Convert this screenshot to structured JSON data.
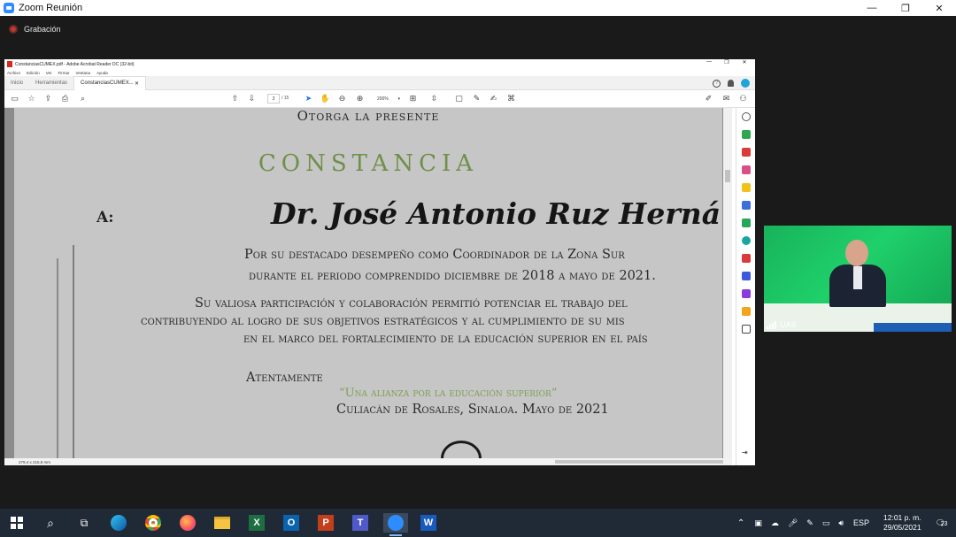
{
  "zoom": {
    "title": "Zoom Reunión",
    "recording_label": "Grabación",
    "participant_name": "UAS"
  },
  "acrobat": {
    "window_title": "ConstanciasCUMEX.pdf - Adobe Acrobat Reader DC (32-bit)",
    "menu": [
      "Archivo",
      "Edición",
      "Ver",
      "Firmar",
      "Ventana",
      "Ayuda"
    ],
    "tabs": {
      "home": "Inicio",
      "tools": "Herramientas",
      "document": "ConstanciasCUMEX..."
    },
    "page_current": "3",
    "page_total": "/ 15",
    "zoom_level": "200%",
    "page_size": "279,4 x 215,9 mm"
  },
  "document": {
    "line_otorga": "Otorga la presente",
    "constancia": "CONSTANCIA",
    "recipient_prefix": "A:",
    "recipient_name": "Dr. José Antonio Ruz Hernández",
    "line1": "Por su destacado desempeño como Coordinador de la Zona Sur",
    "line2": "durante el periodo comprendido diciembre de 2018 a mayo de 2021.",
    "line3": "Su valiosa participación y colaboración permitió potenciar el trabajo del",
    "line4": "contribuyendo al logro de sus objetivos estratégicos y al cumplimiento de su mis",
    "line5": "en el marco del fortalecimiento de la educación superior en el país",
    "atentamente": "Atentamente",
    "motto": "“Una alianza por la educación superior”",
    "place_date": "Culiacán de Rosales, Sinaloa. Mayo de 2021",
    "accent_color": "#6f8f4a"
  },
  "taskbar": {
    "language": "ESP",
    "time": "12:01 p. m.",
    "date": "29/05/2021",
    "notifications": "23"
  }
}
